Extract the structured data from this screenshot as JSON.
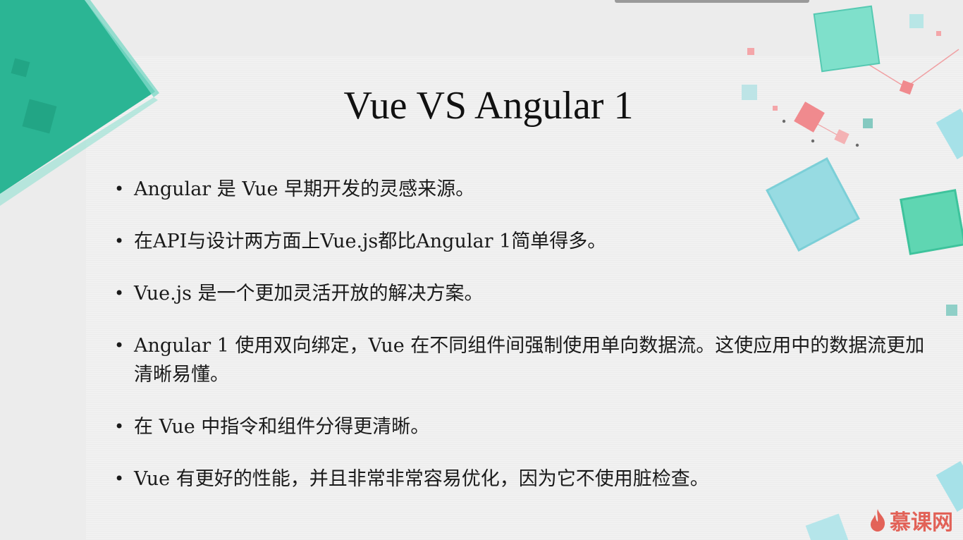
{
  "slide": {
    "title": "Vue VS Angular 1",
    "bullets": [
      "Angular 是 Vue 早期开发的灵感来源。",
      "在API与设计两方面上Vue.js都比Angular 1简单得多。",
      "Vue.js 是一个更加灵活开放的解决方案。",
      "Angular 1 使用双向绑定，Vue 在不同组件间强制使用单向数据流。这使应用中的数据流更加清晰易懂。",
      "在 Vue 中指令和组件分得更清晰。",
      "Vue 有更好的性能，并且非常非常容易优化，因为它不使用脏检查。"
    ]
  },
  "watermark": {
    "text": "慕课网",
    "icon": "flame-icon"
  },
  "colors": {
    "teal": "#2bb594",
    "light_teal": "#7fd9c8",
    "aqua": "#97dbe2",
    "pink": "#f08a8e",
    "logo_red": "#e04a3e"
  }
}
